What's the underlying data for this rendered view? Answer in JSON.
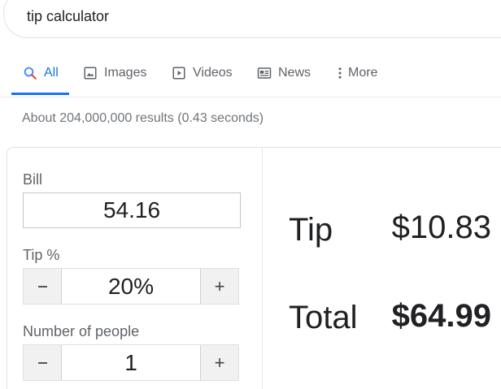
{
  "search": {
    "query": "tip calculator"
  },
  "tabs": [
    {
      "label": "All",
      "icon": "search-icon",
      "active": true
    },
    {
      "label": "Images",
      "icon": "image-icon",
      "active": false
    },
    {
      "label": "Videos",
      "icon": "play-icon",
      "active": false
    },
    {
      "label": "News",
      "icon": "news-icon",
      "active": false
    },
    {
      "label": "More",
      "icon": "more-vert-icon",
      "active": false
    }
  ],
  "results_count": "About 204,000,000 results (0.43 seconds)",
  "calculator": {
    "bill_label": "Bill",
    "bill_value": "54.16",
    "tip_label": "Tip %",
    "tip_value": "20%",
    "people_label": "Number of people",
    "people_value": "1",
    "decrement_label": "-",
    "increment_label": "+",
    "tip_result_label": "Tip",
    "tip_result_value": "$10.83",
    "total_label": "Total",
    "total_value": "$64.99"
  },
  "colors": {
    "accent": "#1a73e8",
    "muted_text": "#70757a"
  }
}
